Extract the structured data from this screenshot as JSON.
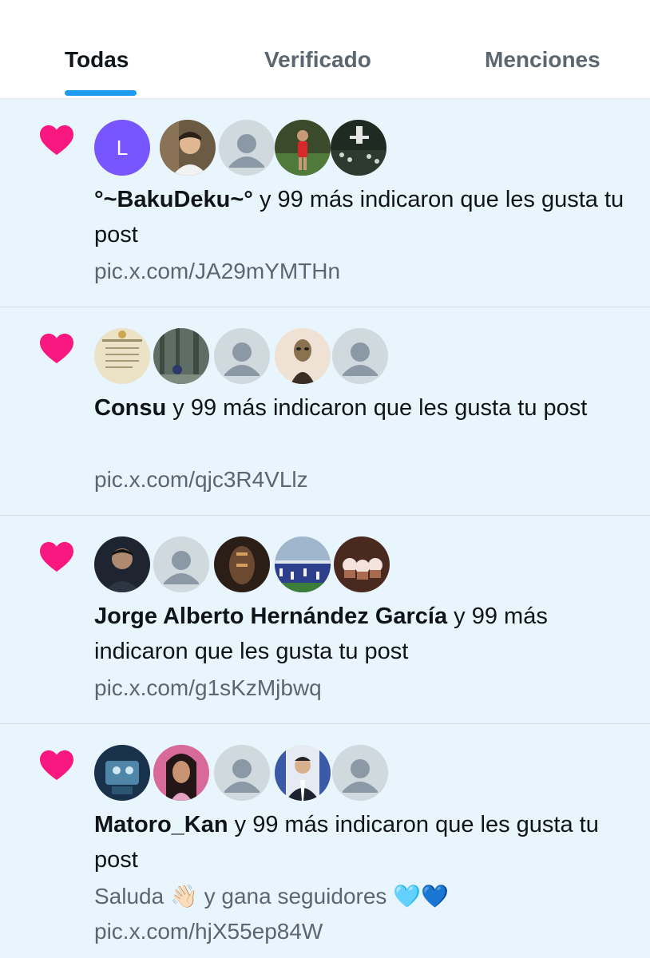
{
  "tabs": [
    {
      "label": "Todas",
      "active": true
    },
    {
      "label": "Verificado",
      "active": false
    },
    {
      "label": "Menciones",
      "active": false
    }
  ],
  "notifications": [
    {
      "avatars": [
        "letter-avatar-L",
        "photo-man-smiling",
        "default-avatar",
        "photo-soccer-player",
        "photo-stadium"
      ],
      "avatar_letter": "L",
      "name": "°~BakuDeku~°",
      "rest": " y 99 más indicaron que les gusta tu post",
      "link": "pic.x.com/JA29mYMTHn"
    },
    {
      "avatars": [
        "photo-poem-paper",
        "photo-forest",
        "default-avatar",
        "photo-alien-figure",
        "default-avatar"
      ],
      "name": "Consu",
      "rest": " y 99 más indicaron que les gusta tu post",
      "link": "pic.x.com/qjc3R4VLlz"
    },
    {
      "avatars": [
        "photo-man-portrait",
        "default-avatar",
        "photo-dark-figure",
        "photo-stadium-crowd",
        "photo-cupcakes"
      ],
      "name": "Jorge Alberto Hernández García",
      "rest": " y 99 más indicaron que les gusta tu post",
      "link": "pic.x.com/g1sKzMjbwq"
    },
    {
      "avatars": [
        "photo-robot",
        "photo-doll",
        "default-avatar",
        "photo-man-suit",
        "default-avatar"
      ],
      "name": "Matoro_Kan",
      "rest": " y 99 más indicaron que les gusta tu post",
      "preview": "Saluda 👋🏻 y gana seguidores 🩵💙",
      "link": "pic.x.com/hjX55ep84W"
    }
  ],
  "colors": {
    "heart": "#f91880",
    "accent": "#1d9bf0",
    "feed_bg": "#e8f5fd",
    "default_avatar": "#cfd9de",
    "letter_avatar": "#7856ff"
  }
}
